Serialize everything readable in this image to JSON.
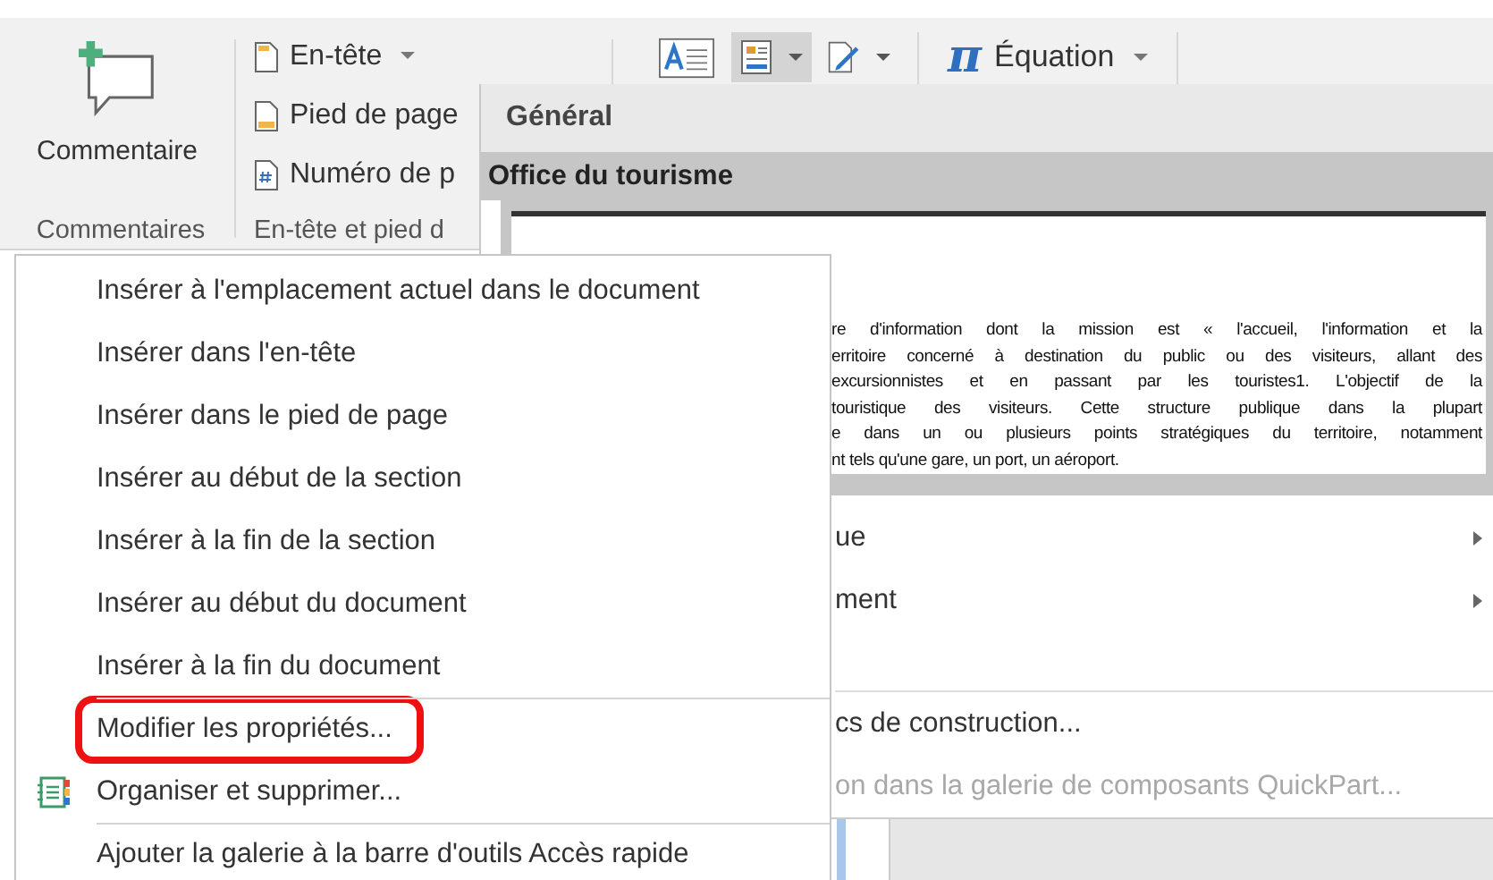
{
  "ribbon": {
    "comment_button": {
      "label": "Commentaire"
    },
    "groups": [
      {
        "label": "Commentaires"
      },
      {
        "label": "En-tête et pied d"
      }
    ],
    "header_items": [
      {
        "kind": "header",
        "label": "En-tête",
        "dropdown": true
      },
      {
        "kind": "footer",
        "label": "Pied de page",
        "dropdown": false
      },
      {
        "kind": "page-number",
        "label": "Numéro de p",
        "dropdown": false
      }
    ],
    "tools": [
      {
        "kind": "textbox",
        "selected": false,
        "dropdown": false
      },
      {
        "kind": "quickparts",
        "selected": true,
        "dropdown": true
      },
      {
        "kind": "signature",
        "selected": false,
        "dropdown": true
      }
    ],
    "equation": {
      "symbol": "π",
      "label": "Équation"
    }
  },
  "gallery": {
    "category": "Général",
    "entry_title": "Office du tourisme",
    "preview_lines": [
      "re d'information dont la mission est « l'accueil, l'information et la",
      "erritoire concerné à destination du public ou des visiteurs, allant des",
      "excursionnistes et en passant par les touristes1. L'objectif de la",
      "touristique des visiteurs. Cette structure publique dans la plupart",
      "e dans un ou plusieurs points stratégiques du territoire, notamment",
      "nt tels qu'une gare, un port, un aéroport."
    ],
    "menu_items": [
      {
        "text": "ue",
        "submenu": true,
        "disabled": false,
        "separator_before": false
      },
      {
        "text": "ment",
        "submenu": true,
        "disabled": false,
        "separator_before": false
      },
      {
        "text": "cs de construction...",
        "submenu": false,
        "disabled": false,
        "separator_before": true
      },
      {
        "text": "on dans la galerie de composants QuickPart...",
        "submenu": false,
        "disabled": true,
        "separator_before": false
      }
    ]
  },
  "context_menu": {
    "items": [
      {
        "text": "Insérer à l'emplacement actuel dans le document",
        "icon": false,
        "highlighted": false,
        "separator_before": false
      },
      {
        "text": "Insérer dans l'en-tête",
        "icon": false,
        "highlighted": false,
        "separator_before": false
      },
      {
        "text": "Insérer dans le pied de page",
        "icon": false,
        "highlighted": false,
        "separator_before": false
      },
      {
        "text": "Insérer au début de la section",
        "icon": false,
        "highlighted": false,
        "separator_before": false
      },
      {
        "text": "Insérer à la fin de la section",
        "icon": false,
        "highlighted": false,
        "separator_before": false
      },
      {
        "text": "Insérer au début du document",
        "icon": false,
        "highlighted": false,
        "separator_before": false
      },
      {
        "text": "Insérer à la fin du document",
        "icon": false,
        "highlighted": false,
        "separator_before": false
      },
      {
        "text": "Modifier les propriétés...",
        "icon": false,
        "highlighted": true,
        "separator_before": true
      },
      {
        "text": "Organiser et supprimer...",
        "icon": true,
        "highlighted": false,
        "separator_before": false
      },
      {
        "text": "Ajouter la galerie à la barre d'outils Accès rapide",
        "icon": false,
        "highlighted": false,
        "separator_before": true
      }
    ]
  }
}
